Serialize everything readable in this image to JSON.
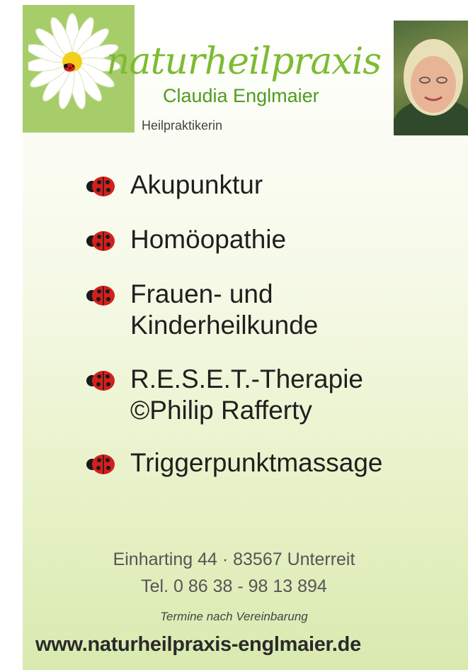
{
  "header": {
    "brand_script": "naturheilpraxis",
    "practitioner_name": "Claudia Englmaier",
    "title": "Heilpraktikerin"
  },
  "services": [
    {
      "line1": "Akupunktur",
      "line2": ""
    },
    {
      "line1": "Homöopathie",
      "line2": ""
    },
    {
      "line1": "Frauen- und",
      "line2": "Kinderheilkunde"
    },
    {
      "line1": "R.E.S.E.T.-Therapie",
      "line2": "©Philip Rafferty"
    },
    {
      "line1": "Triggerpunktmassage",
      "line2": ""
    }
  ],
  "contact": {
    "address": "Einharting 44 · 83567 Unterreit",
    "phone": "Tel. 0 86 38 - 98 13 894",
    "appointment_note": "Termine nach Vereinbarung",
    "website": "www.naturheilpraxis-englmaier.de"
  },
  "colors": {
    "brand_green": "#7dbb33",
    "logo_square": "#a7cd6b",
    "ladybug_red": "#d3201c"
  }
}
